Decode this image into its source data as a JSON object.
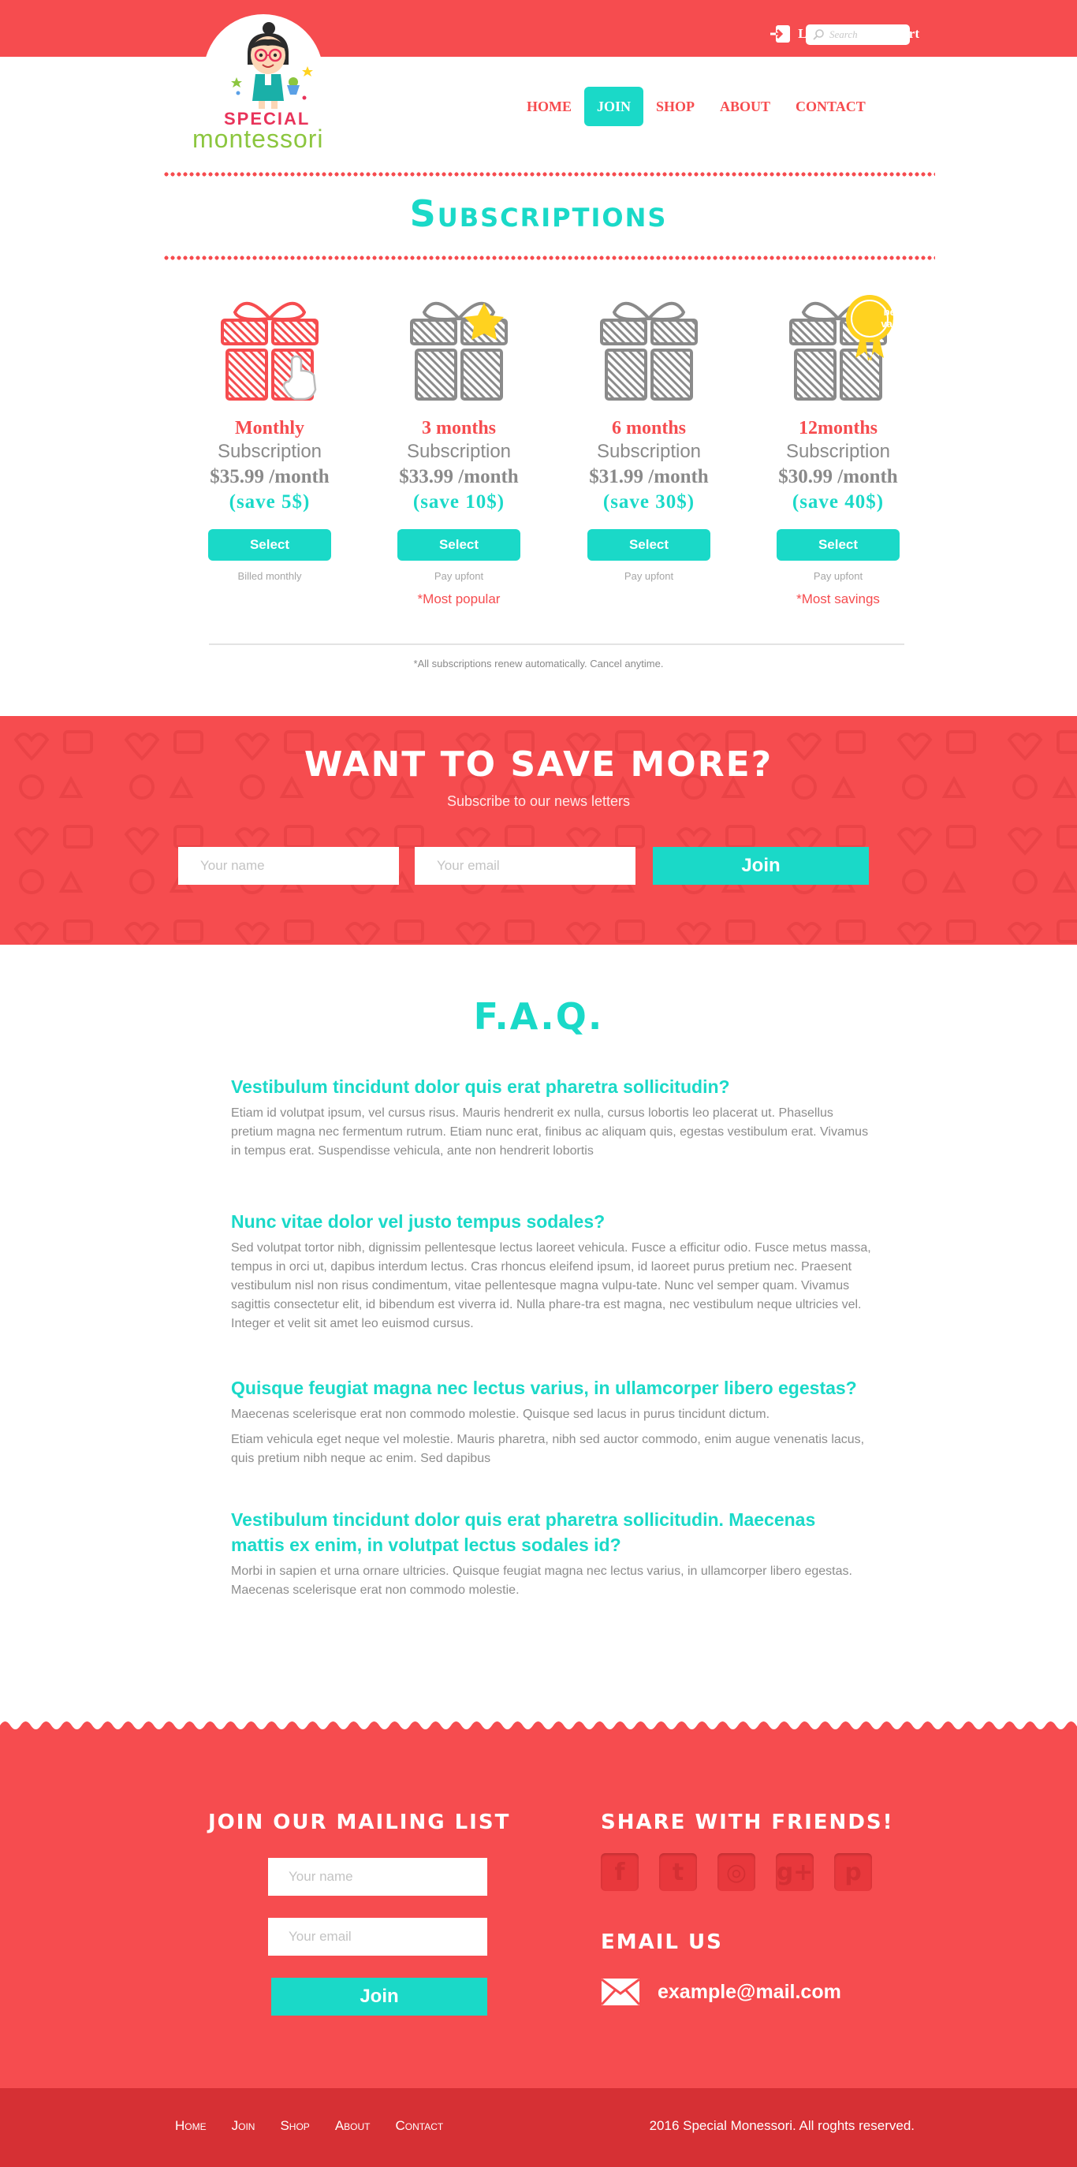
{
  "colors": {
    "brand_red": "#f64c4f",
    "accent_teal": "#1ad9c8",
    "dark_red": "#d63034",
    "gray_text": "#8d8d8d",
    "gold": "#ffd21f"
  },
  "header": {
    "login_label": "Log in",
    "login_icon": "login-icon",
    "cart_label": "Cart",
    "cart_icon": "cart-icon",
    "search_placeholder": "Search",
    "search_icon": "search-icon",
    "logo_line1": "SPECIAL",
    "logo_line2": "montessori"
  },
  "nav": [
    {
      "label": "HOME",
      "active": false
    },
    {
      "label": "JOIN",
      "active": true
    },
    {
      "label": "SHOP",
      "active": false
    },
    {
      "label": "ABOUT",
      "active": false
    },
    {
      "label": "CONTACT",
      "active": false
    }
  ],
  "page_title": "Subscriptions",
  "plans": [
    {
      "name": "Monthly",
      "subtitle": "Subscription",
      "price": "$35.99 /month",
      "save": "(save 5$)",
      "button": "Select",
      "billing": "Billed monthly",
      "tag": "",
      "badge": "",
      "highlighted": true
    },
    {
      "name": "3 months",
      "subtitle": "Subscription",
      "price": "$33.99 /month",
      "save": "(save 10$)",
      "button": "Select",
      "billing": "Pay upfont",
      "tag": "*Most popular",
      "badge": "star",
      "highlighted": false
    },
    {
      "name": "6 months",
      "subtitle": "Subscription",
      "price": "$31.99 /month",
      "save": "(save 30$)",
      "button": "Select",
      "billing": "Pay upfont",
      "tag": "",
      "badge": "",
      "highlighted": false
    },
    {
      "name": "12months",
      "subtitle": "Subscription",
      "price": "$30.99 /month",
      "save": "(save 40$)",
      "button": "Select",
      "billing": "Pay upfont",
      "tag": "*Most savings",
      "badge": "best value",
      "highlighted": false
    }
  ],
  "plans_note": "*All subscriptions renew automatically. Cancel anytime.",
  "newsletter": {
    "title": "Want to save more?",
    "subtitle": "Subscribe to our news letters",
    "name_placeholder": "Your name",
    "email_placeholder": "Your email",
    "button": "Join"
  },
  "faq": {
    "title": "F.A.Q.",
    "items": [
      {
        "question": "Vestibulum tincidunt dolor quis erat pharetra sollicitudin?",
        "answers": [
          "Etiam id volutpat ipsum, vel cursus risus. Mauris hendrerit ex nulla, cursus lobortis leo placerat ut. Phasellus pretium magna nec fermentum rutrum. Etiam nunc erat, finibus ac aliquam quis, egestas vestibulum erat. Vivamus in tempus erat. Suspendisse vehicula, ante non hendrerit lobortis"
        ]
      },
      {
        "question": "Nunc vitae dolor vel justo tempus sodales?",
        "answers": [
          "Sed volutpat tortor nibh, dignissim pellentesque lectus laoreet vehicula. Fusce a efficitur odio. Fusce metus massa, tempus in orci ut, dapibus interdum lectus. Cras rhoncus eleifend ipsum, id laoreet purus pretium nec. Praesent vestibulum nisl non risus condimentum, vitae pellentesque magna vulpu-tate. Nunc vel semper quam. Vivamus sagittis consectetur elit, id bibendum est viverra id. Nulla phare-tra est magna, nec vestibulum neque ultricies vel. Integer et velit sit amet leo euismod cursus."
        ]
      },
      {
        "question": "Quisque feugiat magna nec lectus varius, in ullamcorper libero egestas?",
        "answers": [
          "Maecenas scelerisque erat non commodo molestie. Quisque sed lacus in purus tincidunt dictum.",
          "Etiam vehicula eget neque vel molestie. Mauris pharetra, nibh sed auctor commodo, enim augue venenatis lacus, quis pretium nibh neque ac enim. Sed dapibus"
        ]
      },
      {
        "question": "Vestibulum tincidunt dolor quis erat pharetra sollicitudin. Maecenas mattis ex enim, in volutpat lectus sodales id?",
        "answers": [
          "Morbi in sapien et urna ornare ultricies. Quisque feugiat magna nec lectus varius, in ullamcorper libero egestas. Maecenas scelerisque erat non commodo molestie."
        ]
      }
    ]
  },
  "footer": {
    "mailing_title": "Join our mailing list",
    "name_placeholder": "Your name",
    "email_placeholder": "Your email",
    "join_button": "Join",
    "share_title": "Share with friends!",
    "social": [
      {
        "icon": "facebook-icon",
        "glyph": "f"
      },
      {
        "icon": "twitter-icon",
        "glyph": "t"
      },
      {
        "icon": "instagram-icon",
        "glyph": "◎"
      },
      {
        "icon": "google-plus-icon",
        "glyph": "g+"
      },
      {
        "icon": "pinterest-icon",
        "glyph": "p"
      }
    ],
    "email_title": "Email us",
    "email_icon": "envelope-icon",
    "email": "example@mail.com"
  },
  "bottom": {
    "links": [
      "Home",
      "Join",
      "Shop",
      "About",
      "Contact"
    ],
    "copyright": "2016 Special Monessori. All roghts reserved."
  }
}
